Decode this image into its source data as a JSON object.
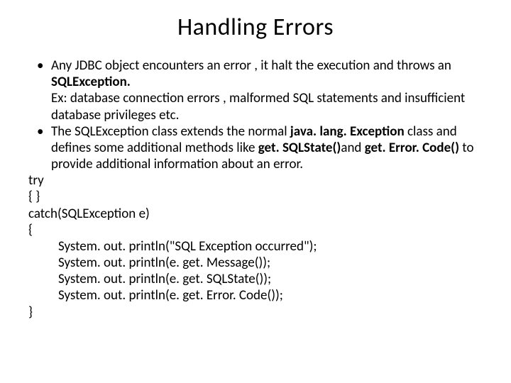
{
  "title": "Handling Errors",
  "bullets": {
    "b1": "Any JDBC object encounters an error , it halt  the execution and throws an ",
    "b1_bold": "SQLException.",
    "b1_ex": "Ex: database connection errors , malformed SQL statements and insufficient database privileges etc.",
    "b2_a": "The SQLException class extends the normal ",
    "b2_bold1": "java. lang. Exception",
    "b2_b": " class and defines some additional methods like ",
    "b2_bold2": "get. SQLState()",
    "b2_c": "and ",
    "b2_bold3": "get. Error. Code()",
    "b2_d": " to provide additional information about an error."
  },
  "code": {
    "l1": "try",
    "l2": "{  }",
    "l3": "catch(SQLException e)",
    "l4": "{",
    "l5": "System. out. println(\"SQL Exception occurred\");",
    "l6": "System. out. println(e. get. Message());",
    "l7": "System. out. println(e. get. SQLState());",
    "l8": "System. out. println(e. get. Error. Code());",
    "l9": "}"
  }
}
